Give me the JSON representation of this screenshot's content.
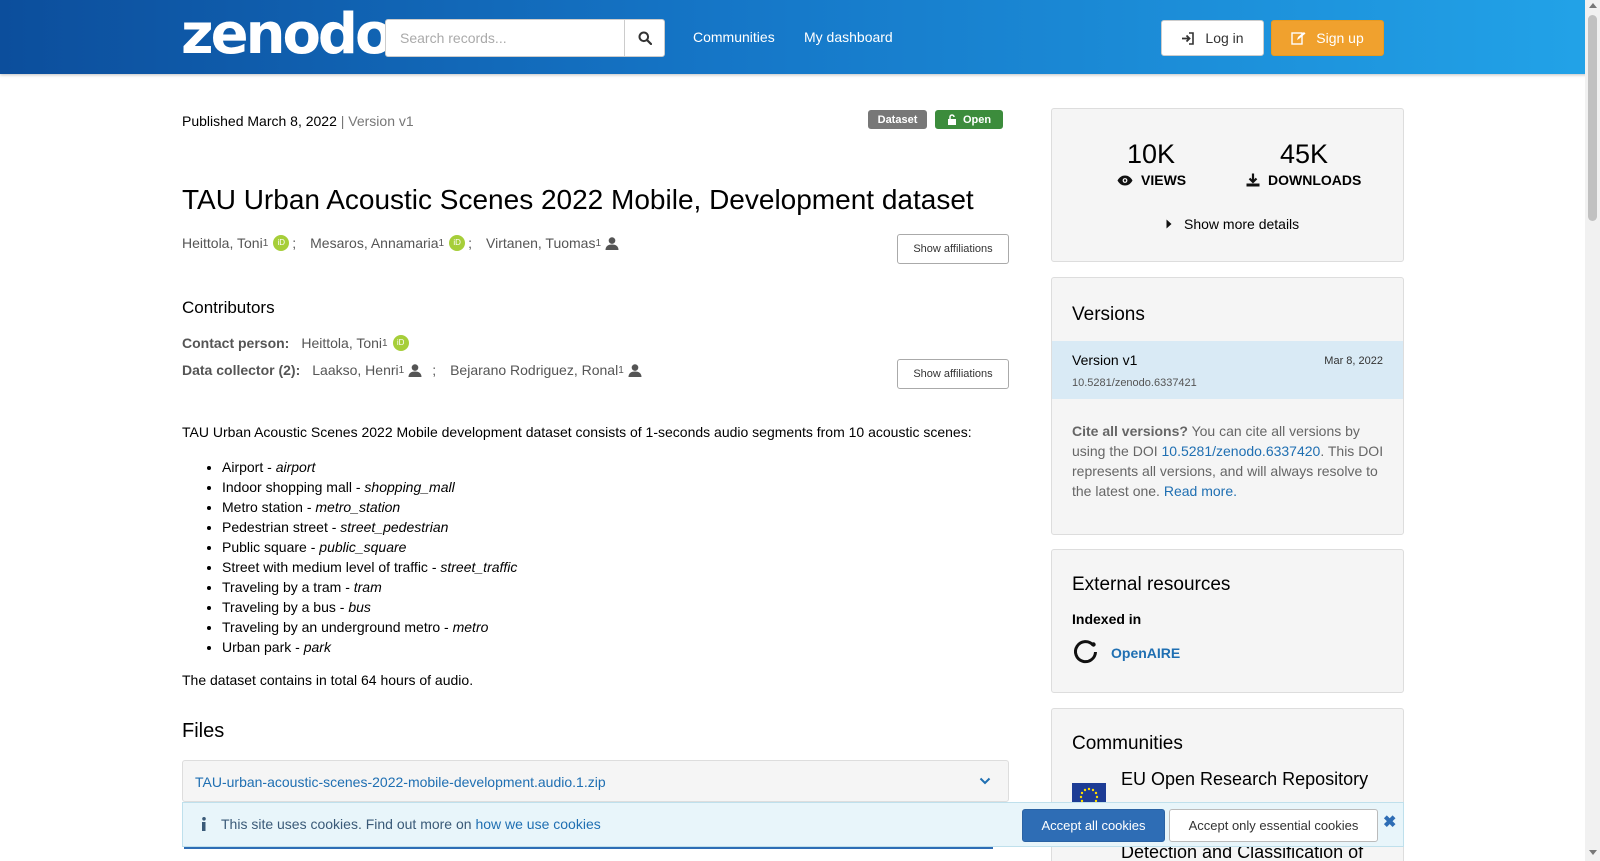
{
  "header": {
    "logo": "zenodo",
    "search_placeholder": "Search records...",
    "nav": [
      "Communities",
      "My dashboard"
    ],
    "login_label": "Log in",
    "signup_label": "Sign up"
  },
  "record": {
    "published": "Published March 8, 2022",
    "version_sep": " | ",
    "version": "Version v1",
    "badge_type": "Dataset",
    "badge_access": "Open",
    "title": "TAU Urban Acoustic Scenes 2022 Mobile, Development dataset",
    "creators": [
      {
        "name": "Heittola, Toni",
        "sup": "1",
        "id_type": "orcid"
      },
      {
        "name": "Mesaros, Annamaria",
        "sup": "1",
        "id_type": "orcid"
      },
      {
        "name": "Virtanen, Tuomas",
        "sup": "1",
        "id_type": "person"
      }
    ],
    "show_affiliations": "Show affiliations",
    "contributors_heading": "Contributors",
    "contact_label": "Contact person:",
    "contact_name": "Heittola, Toni",
    "contact_sup": "1",
    "collector_label": "Data collector (2):",
    "collectors": [
      {
        "name": "Laakso, Henri",
        "sup": "1"
      },
      {
        "name": "Bejarano Rodriguez, Ronal",
        "sup": "1"
      }
    ],
    "description": "TAU Urban Acoustic Scenes 2022 Mobile development dataset consists of 1-seconds audio segments from 10 acoustic scenes:",
    "scenes": [
      {
        "label": "Airport - ",
        "code": "airport"
      },
      {
        "label": "Indoor shopping mall - ",
        "code": "shopping_mall"
      },
      {
        "label": "Metro station - ",
        "code": "metro_station"
      },
      {
        "label": "Pedestrian street - ",
        "code": "street_pedestrian"
      },
      {
        "label": "Public square - ",
        "code": "public_square"
      },
      {
        "label": "Street with medium level of traffic - ",
        "code": "street_traffic"
      },
      {
        "label": "Traveling by a tram - ",
        "code": "tram"
      },
      {
        "label": "Traveling by a bus - ",
        "code": "bus"
      },
      {
        "label": "Traveling by an underground metro - ",
        "code": "metro"
      },
      {
        "label": "Urban park - ",
        "code": "park"
      }
    ],
    "total_audio": "The dataset contains in total 64 hours of audio.",
    "files_heading": "Files",
    "file_name": "TAU-urban-acoustic-scenes-2022-mobile-development.audio.1.zip"
  },
  "stats": {
    "views": "10K",
    "views_label": "VIEWS",
    "downloads": "45K",
    "downloads_label": "DOWNLOADS",
    "more_details": "Show more details"
  },
  "versions": {
    "heading": "Versions",
    "current_name": "Version v1",
    "current_date": "Mar 8, 2022",
    "current_doi": "10.5281/zenodo.6337421",
    "cite_bold": "Cite all versions?",
    "cite_text1": " You can cite all versions by using the DOI ",
    "cite_doi": "10.5281/zenodo.6337420",
    "cite_text2": ". This DOI represents all versions, and will always resolve to the latest one. ",
    "read_more": "Read more."
  },
  "external": {
    "heading": "External resources",
    "indexed": "Indexed in",
    "openaire": "OpenAIRE"
  },
  "communities": {
    "heading": "Communities",
    "item1": "EU Open Research Repository",
    "item2": "Detection and Classification of"
  },
  "cookie": {
    "text": "This site uses cookies. Find out more on ",
    "link": "how we use cookies",
    "accept_all": "Accept all cookies",
    "accept_essential": "Accept only essential cookies"
  },
  "colors": {
    "header_start": "#0c4e9c",
    "header_end": "#22a3e8",
    "signup": "#f0a12e",
    "link": "#1f6fb2",
    "open_badge": "#3c8c3c",
    "orcid": "#a6ce39"
  }
}
